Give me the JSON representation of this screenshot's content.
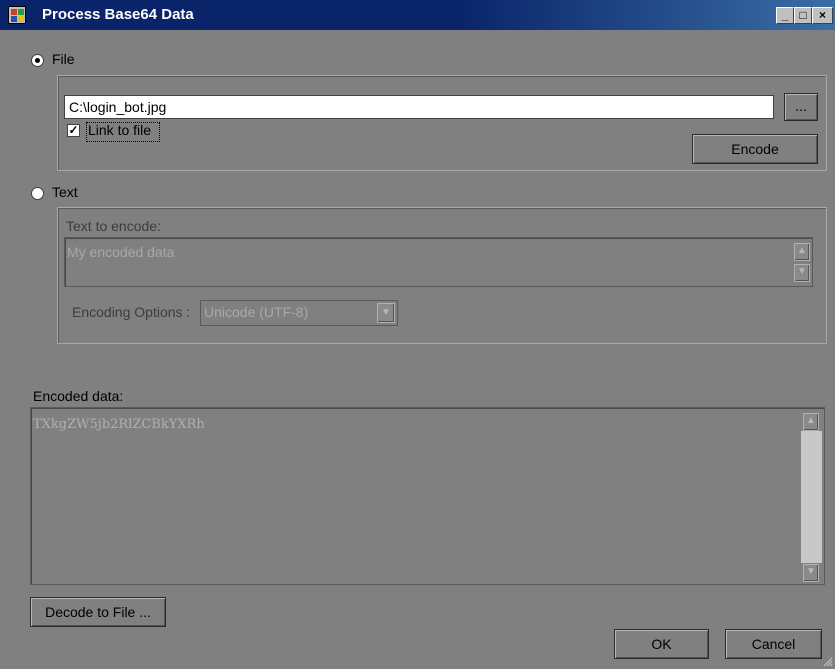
{
  "window": {
    "title": "Process Base64 Data",
    "controls": {
      "minimize": "_",
      "maximize": "□",
      "close": "×"
    }
  },
  "file_option": {
    "label": "File",
    "selected": true,
    "path_value": "C:\\login_bot.jpg",
    "browse_label": "...",
    "link_checkbox_label": "Link to file",
    "link_checked": true,
    "encode_label": "Encode"
  },
  "text_option": {
    "label": "Text",
    "selected": false,
    "text_to_encode_label": "Text to encode:",
    "text_value": "My encoded data",
    "encoding_options_label": "Encoding Options :",
    "encoding_value": "Unicode (UTF-8)"
  },
  "encoded": {
    "label": "Encoded data:",
    "value": "TXkgZW5jb2RlZCBkYXRh"
  },
  "buttons": {
    "decode_to_file": "Decode to File ...",
    "ok": "OK",
    "cancel": "Cancel"
  },
  "icons": {
    "app": "app-icon",
    "radio_checked": "radio-checked",
    "scroll_up": "▲",
    "scroll_down": "▼",
    "dropdown": "▼"
  },
  "colors": {
    "title_bar": "#0a246a",
    "window_bg": "#808080"
  }
}
